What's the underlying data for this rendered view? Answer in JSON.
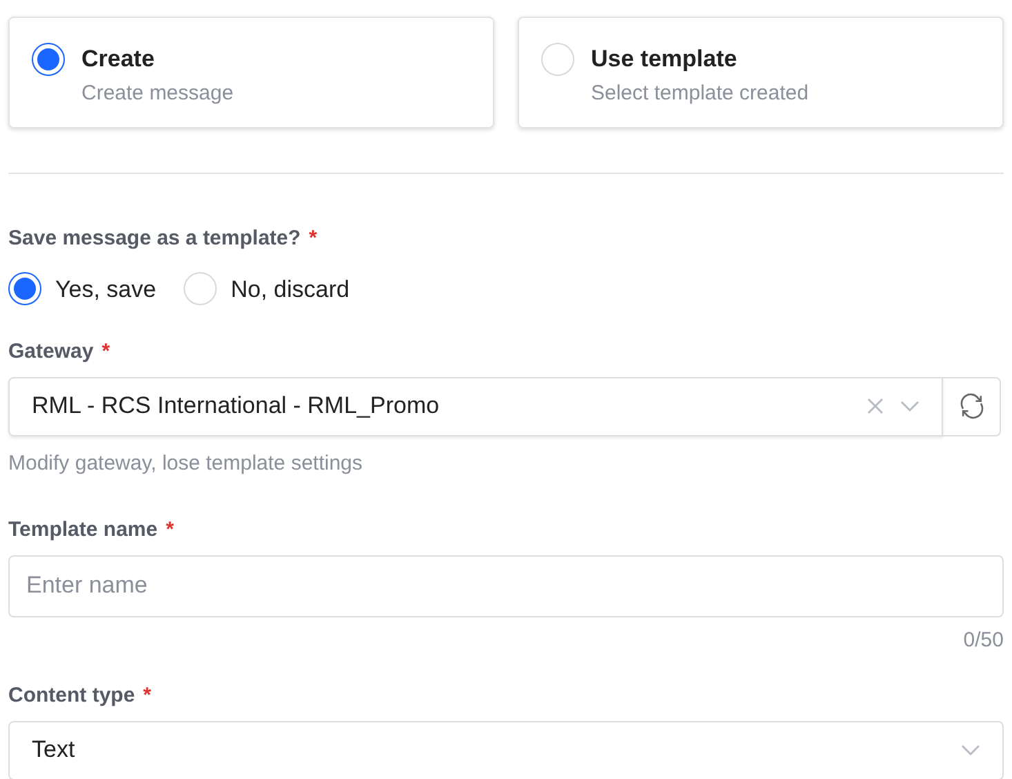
{
  "modes": [
    {
      "title": "Create",
      "subtitle": "Create message",
      "selected": true
    },
    {
      "title": "Use template",
      "subtitle": "Select template created",
      "selected": false
    }
  ],
  "save_template": {
    "label": "Save message as a template?",
    "required_mark": "*",
    "options": [
      {
        "label": "Yes, save",
        "selected": true
      },
      {
        "label": "No, discard",
        "selected": false
      }
    ]
  },
  "gateway": {
    "label": "Gateway",
    "required_mark": "*",
    "value": "RML - RCS International - RML_Promo",
    "hint": "Modify gateway, lose template settings"
  },
  "template_name": {
    "label": "Template name",
    "required_mark": "*",
    "placeholder": "Enter name",
    "counter": "0/50"
  },
  "content_type": {
    "label": "Content type",
    "required_mark": "*",
    "value": "Text"
  }
}
